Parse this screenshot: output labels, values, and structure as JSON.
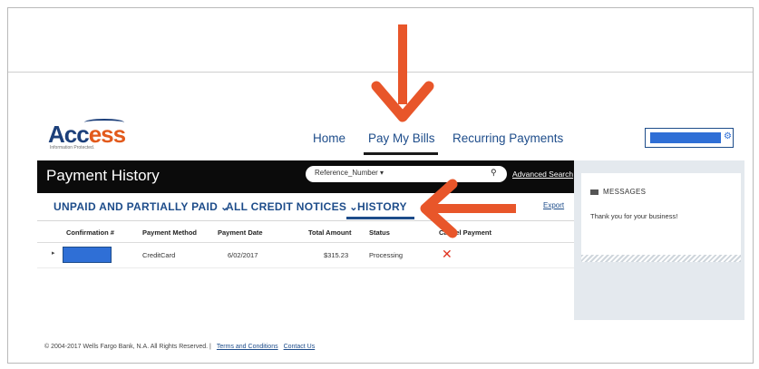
{
  "header": {
    "logo_text_accent": "Acc",
    "logo_text_rest": "ess",
    "logo_tagline": "Information Protected.",
    "nav": {
      "home": "Home",
      "pay_my_bills": "Pay My Bills",
      "recurring_payments": "Recurring Payments"
    }
  },
  "payment_history": {
    "title": "Payment History",
    "search_select": "Reference_Number ▾",
    "advanced_search": "Advanced Search"
  },
  "tabs": {
    "unpaid": "UNPAID AND PARTIALLY PAID",
    "credit_notices": "ALL CREDIT NOTICES",
    "history": "HISTORY",
    "export": "Export"
  },
  "table": {
    "columns": [
      "Confirmation #",
      "Payment Method",
      "Payment Date",
      "Total Amount",
      "Status",
      "Cancel Payment"
    ],
    "rows": [
      {
        "payment_method": "CreditCard",
        "payment_date": "6/02/2017",
        "total_amount": "$315.23",
        "status": "Processing"
      }
    ]
  },
  "messages": {
    "heading": "MESSAGES",
    "text": "Thank you for your business!"
  },
  "footer": {
    "copyright": "© 2004-2017 Wells Fargo Bank, N.A. All Rights Reserved.  |",
    "terms": "Terms and Conditions",
    "contact": "Contact Us"
  },
  "colors": {
    "accent_orange": "#e8562a",
    "brand_blue": "#1d4c8a",
    "redacted_blue": "#2f6fd6"
  }
}
